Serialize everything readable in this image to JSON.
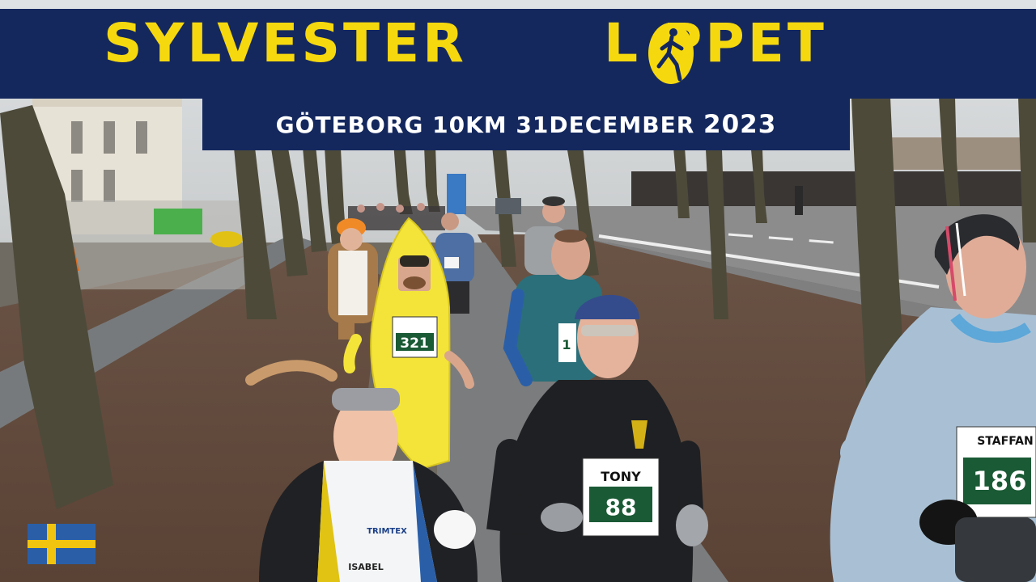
{
  "banner": {
    "title_left": "SYLVESTER",
    "title_right": "L PPET",
    "subtitle": "GÖTEBORG 10KM 31DECEMBER",
    "year": "2023",
    "bg_color": "#14285e",
    "title_color": "#f6d80f"
  },
  "bibs": {
    "banana": "321",
    "tony_name": "TONY",
    "tony_number": "88",
    "staffan_name": "STAFFAN",
    "staffan_number": "186",
    "teal_runner": "1"
  },
  "jersey": {
    "brand": "TRIMTEX",
    "name": "ISABEL"
  },
  "flag": {
    "country": "Sweden",
    "blue": "#2a5fa8",
    "yellow": "#f1c40f"
  }
}
